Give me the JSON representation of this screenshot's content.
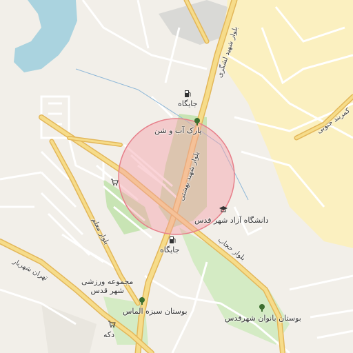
{
  "map": {
    "labels": {
      "gas1": "جایگاه",
      "gas2": "جایگاه",
      "park": "پارک آب و شن",
      "university": "دانشگاه آزاد شهر قدس",
      "sports_line1": "مجموعه ورزشی",
      "sports_line2": "شهر قدس",
      "park_almas": "بوستان سبزه الماس",
      "park_banovan": "بوستان بانوان شهرقدس",
      "shop": "دکه",
      "road_pasdaran": "بلوار شهید لشگری",
      "road_pasdaran_2": "بلوار شهید بهشتی",
      "road_hejab": "بلوار حجاب",
      "road_moallem": "بلوار معلم",
      "road_tehran": "تهران شهریار",
      "road_kamarbandi": "کمربند جنوبی"
    },
    "colors": {
      "background": "#f2efe9",
      "water": "#aad3df",
      "residential": "#fbf0b8",
      "green": "#c7e6b3",
      "road_major": "#f5d985",
      "road_major_edge": "#e3b75a",
      "road_minor": "#ffffff",
      "search_circle": "#f2a0a8"
    },
    "icons": [
      "fuel-icon",
      "tree-icon",
      "university-icon",
      "shop-cart-icon"
    ],
    "search_area": "circle highlight around Park Ab-o-Shen"
  }
}
